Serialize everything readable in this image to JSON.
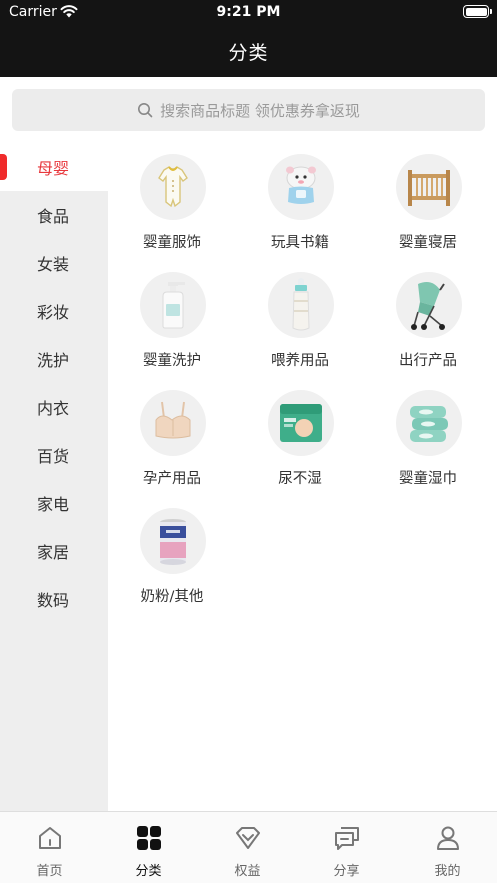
{
  "status_bar": {
    "carrier": "Carrier",
    "time": "9:21 PM"
  },
  "header": {
    "title": "分类"
  },
  "search": {
    "placeholder": "搜索商品标题 领优惠券拿返现"
  },
  "sidebar": {
    "items": [
      {
        "label": "母婴",
        "active": true
      },
      {
        "label": "食品"
      },
      {
        "label": "女装"
      },
      {
        "label": "彩妆"
      },
      {
        "label": "洗护"
      },
      {
        "label": "内衣"
      },
      {
        "label": "百货"
      },
      {
        "label": "家电"
      },
      {
        "label": "家居"
      },
      {
        "label": "数码"
      }
    ]
  },
  "categories": [
    {
      "label": "婴童服饰",
      "icon": "baby-romper-icon"
    },
    {
      "label": "玩具书籍",
      "icon": "toy-figure-icon"
    },
    {
      "label": "婴童寝居",
      "icon": "crib-icon"
    },
    {
      "label": "婴童洗护",
      "icon": "wash-bottle-icon"
    },
    {
      "label": "喂养用品",
      "icon": "feeding-bottle-icon"
    },
    {
      "label": "出行产品",
      "icon": "stroller-icon"
    },
    {
      "label": "孕产用品",
      "icon": "maternity-bra-icon"
    },
    {
      "label": "尿不湿",
      "icon": "diaper-pack-icon"
    },
    {
      "label": "婴童湿巾",
      "icon": "wet-wipes-icon"
    },
    {
      "label": "奶粉/其他",
      "icon": "milk-powder-can-icon"
    }
  ],
  "tabbar": {
    "tabs": [
      {
        "label": "首页",
        "icon": "home-icon"
      },
      {
        "label": "分类",
        "icon": "category-grid-icon",
        "active": true
      },
      {
        "label": "权益",
        "icon": "diamond-icon"
      },
      {
        "label": "分享",
        "icon": "share-chat-icon"
      },
      {
        "label": "我的",
        "icon": "profile-icon"
      }
    ]
  },
  "colors": {
    "accent": "#e8383d",
    "header_bg": "#141414",
    "sidebar_bg": "#eeeeee"
  }
}
